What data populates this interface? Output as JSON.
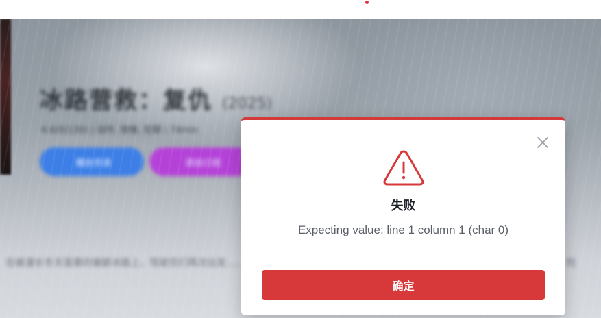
{
  "background": {
    "title": "冰路营救：复仇",
    "year": "(2025)",
    "meta": "4.6/0(130) | 动作, 惊悚, 犯罪 | 74min",
    "primary_button": "播放资源",
    "secondary_button": "添加订阅",
    "description": "在被漫长冬天笼罩的偏僻冰路上，驾驶员们再次出发……",
    "description_right": "险"
  },
  "dialog": {
    "title": "失败",
    "message": "Expecting value: line 1 column 1 (char 0)",
    "confirm_label": "确定",
    "icon": "warning-triangle-icon",
    "close_icon": "close-icon",
    "accent_color": "#d7393a"
  }
}
